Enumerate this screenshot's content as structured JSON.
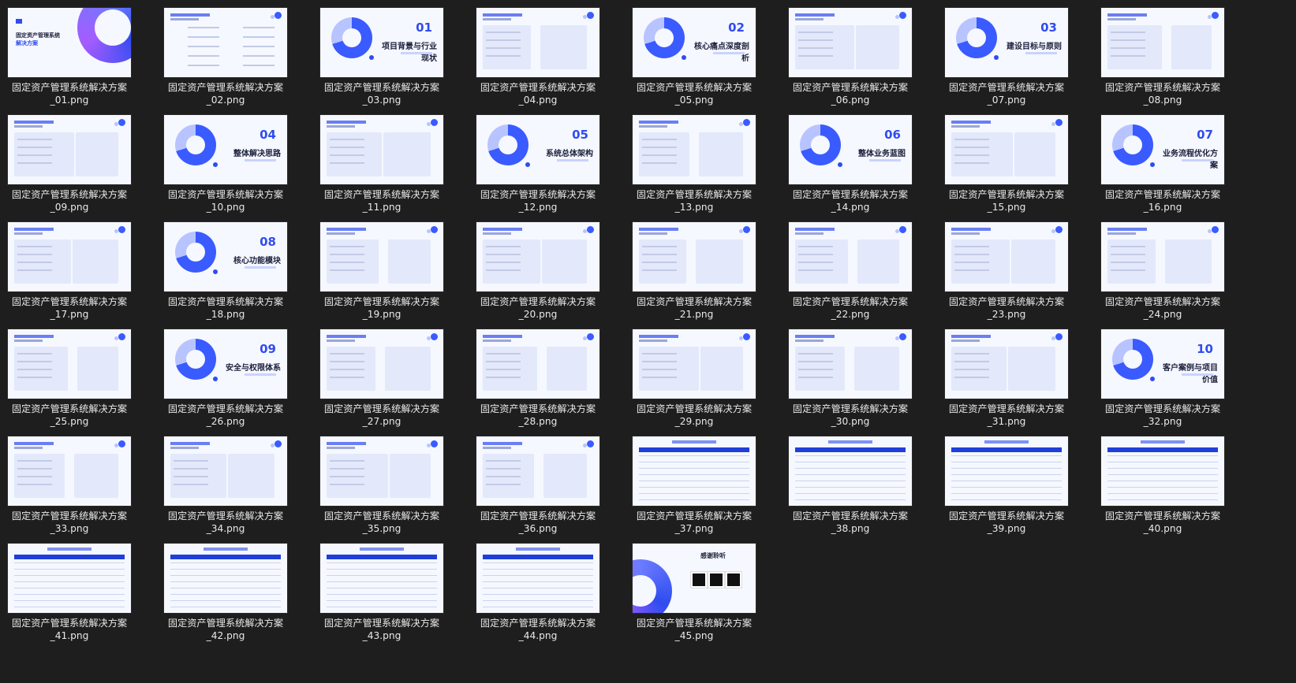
{
  "caption_prefix": "固定资产管理系统解决方案",
  "thumbnails": [
    {
      "file": "_01.png",
      "kind": "cover",
      "heading": "固定资产管理系统",
      "subheading": "解决方案"
    },
    {
      "file": "_02.png",
      "kind": "toc",
      "heading": "目 录"
    },
    {
      "file": "_03.png",
      "kind": "section",
      "number": "01",
      "heading": "项目背景与行业现状"
    },
    {
      "file": "_04.png",
      "kind": "content"
    },
    {
      "file": "_05.png",
      "kind": "section",
      "number": "02",
      "heading": "核心痛点深度剖析"
    },
    {
      "file": "_06.png",
      "kind": "content"
    },
    {
      "file": "_07.png",
      "kind": "section",
      "number": "03",
      "heading": "建设目标与原则"
    },
    {
      "file": "_08.png",
      "kind": "content"
    },
    {
      "file": "_09.png",
      "kind": "content"
    },
    {
      "file": "_10.png",
      "kind": "section",
      "number": "04",
      "heading": "整体解决思路"
    },
    {
      "file": "_11.png",
      "kind": "content"
    },
    {
      "file": "_12.png",
      "kind": "section",
      "number": "05",
      "heading": "系统总体架构"
    },
    {
      "file": "_13.png",
      "kind": "content"
    },
    {
      "file": "_14.png",
      "kind": "section",
      "number": "06",
      "heading": "整体业务蓝图"
    },
    {
      "file": "_15.png",
      "kind": "content"
    },
    {
      "file": "_16.png",
      "kind": "section",
      "number": "07",
      "heading": "业务流程优化方案"
    },
    {
      "file": "_17.png",
      "kind": "content"
    },
    {
      "file": "_18.png",
      "kind": "section",
      "number": "08",
      "heading": "核心功能模块"
    },
    {
      "file": "_19.png",
      "kind": "content"
    },
    {
      "file": "_20.png",
      "kind": "content"
    },
    {
      "file": "_21.png",
      "kind": "content"
    },
    {
      "file": "_22.png",
      "kind": "content"
    },
    {
      "file": "_23.png",
      "kind": "content"
    },
    {
      "file": "_24.png",
      "kind": "content"
    },
    {
      "file": "_25.png",
      "kind": "content"
    },
    {
      "file": "_26.png",
      "kind": "section",
      "number": "09",
      "heading": "安全与权限体系"
    },
    {
      "file": "_27.png",
      "kind": "content"
    },
    {
      "file": "_28.png",
      "kind": "content"
    },
    {
      "file": "_29.png",
      "kind": "content"
    },
    {
      "file": "_30.png",
      "kind": "content"
    },
    {
      "file": "_31.png",
      "kind": "content"
    },
    {
      "file": "_32.png",
      "kind": "section",
      "number": "10",
      "heading": "客户案例与项目价值"
    },
    {
      "file": "_33.png",
      "kind": "content"
    },
    {
      "file": "_34.png",
      "kind": "content"
    },
    {
      "file": "_35.png",
      "kind": "content"
    },
    {
      "file": "_36.png",
      "kind": "content"
    },
    {
      "file": "_37.png",
      "kind": "table"
    },
    {
      "file": "_38.png",
      "kind": "table"
    },
    {
      "file": "_39.png",
      "kind": "table"
    },
    {
      "file": "_40.png",
      "kind": "table"
    },
    {
      "file": "_41.png",
      "kind": "table"
    },
    {
      "file": "_42.png",
      "kind": "table"
    },
    {
      "file": "_43.png",
      "kind": "table"
    },
    {
      "file": "_44.png",
      "kind": "table"
    },
    {
      "file": "_45.png",
      "kind": "thanks",
      "heading": "感谢聆听"
    }
  ]
}
